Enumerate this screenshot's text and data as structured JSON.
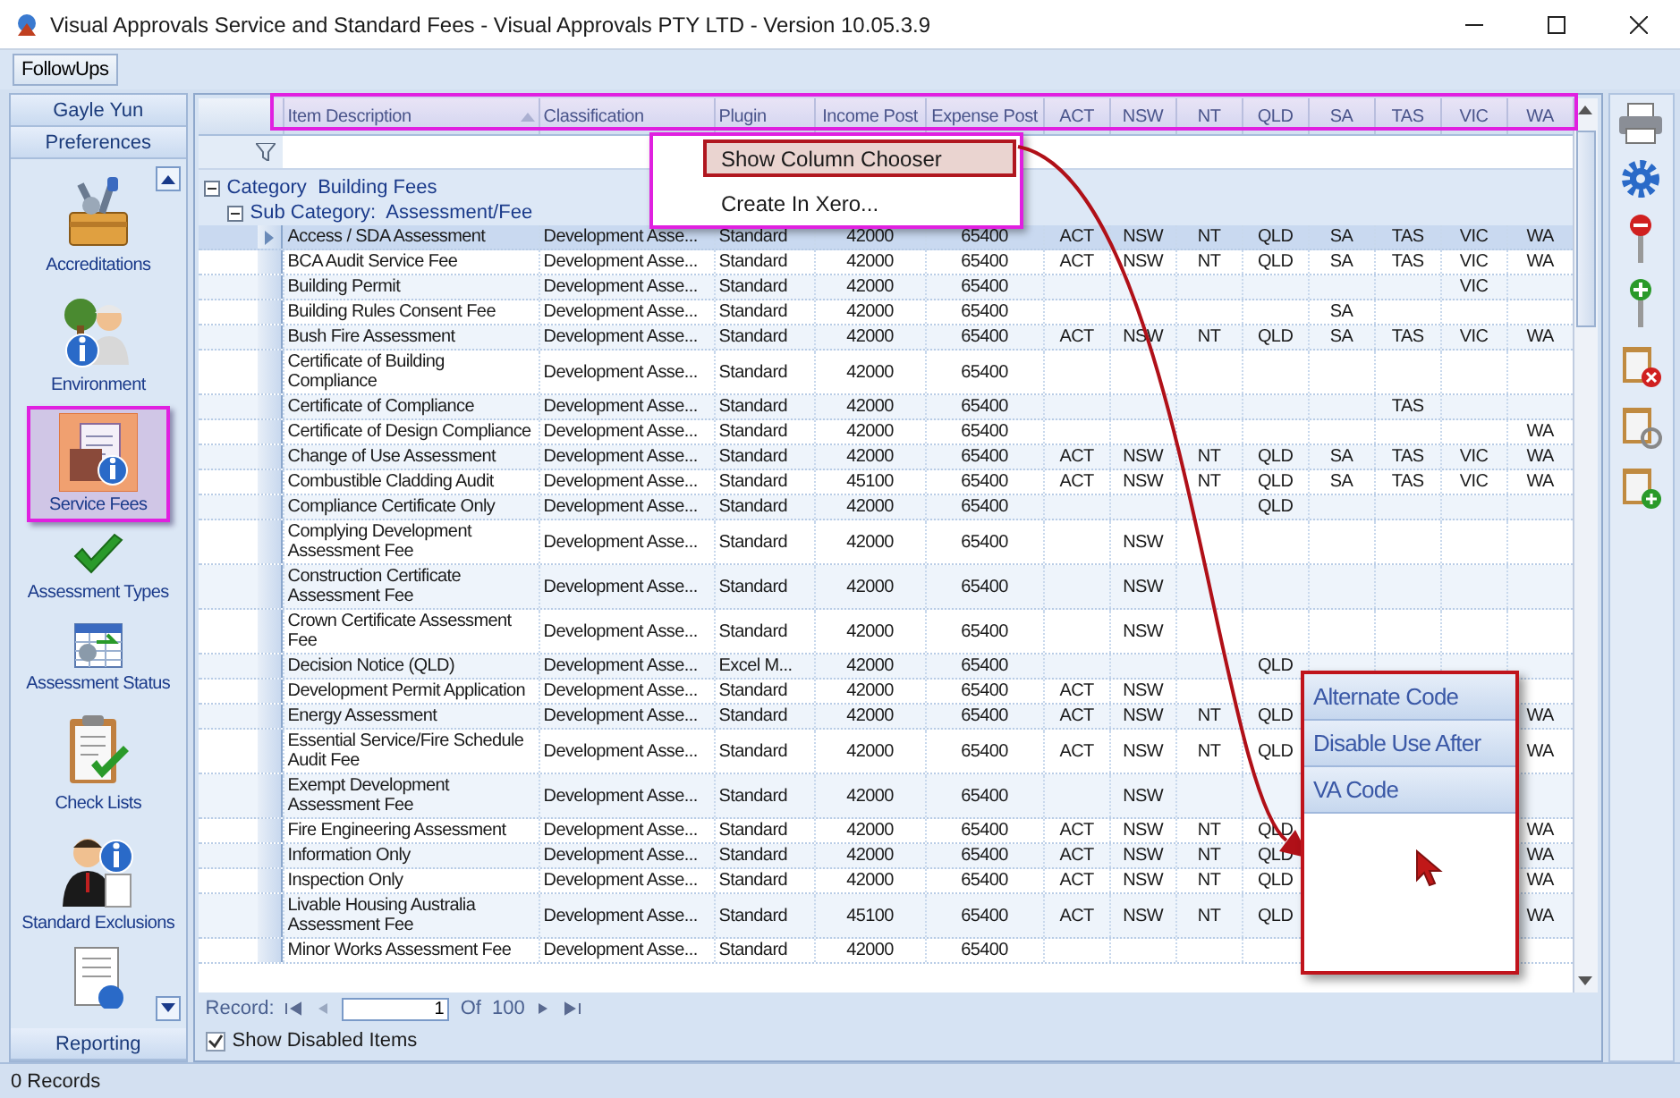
{
  "window": {
    "title": "Visual Approvals Service and Standard Fees - Visual Approvals PTY LTD - Version 10.05.3.9"
  },
  "toolbar": {
    "buttons": [
      "FollowUps"
    ]
  },
  "sidebar": {
    "user": "Gayle Yun",
    "section": "Preferences",
    "items": [
      {
        "label": "Accreditations",
        "selected": false
      },
      {
        "label": "Environment",
        "selected": false
      },
      {
        "label": "Service Fees",
        "selected": true
      },
      {
        "label": "Assessment Types",
        "selected": false
      },
      {
        "label": "Assessment Status",
        "selected": false
      },
      {
        "label": "Check Lists",
        "selected": false
      },
      {
        "label": "Standard Exclusions",
        "selected": false
      }
    ],
    "footer": "Reporting"
  },
  "grid": {
    "columns": [
      {
        "label": "Item Description",
        "sorted": true
      },
      {
        "label": "Classification",
        "sorted": false
      },
      {
        "label": "Plugin",
        "sorted": false
      },
      {
        "label": "Income Post",
        "sorted": false
      },
      {
        "label": "Expense Post",
        "sorted": false
      },
      {
        "label": "ACT",
        "sorted": false
      },
      {
        "label": "NSW",
        "sorted": false
      },
      {
        "label": "NT",
        "sorted": false
      },
      {
        "label": "QLD",
        "sorted": false
      },
      {
        "label": "SA",
        "sorted": false
      },
      {
        "label": "TAS",
        "sorted": false
      },
      {
        "label": "VIC",
        "sorted": false
      },
      {
        "label": "WA",
        "sorted": false
      }
    ],
    "groups": [
      {
        "label": "Category",
        "value": "Building Fees",
        "expanded": true
      },
      {
        "label": "Sub Category:",
        "value": "Assessment/Fee",
        "expanded": true
      }
    ],
    "rows": [
      {
        "selected": true,
        "cells": [
          "Access / SDA Assessment",
          "Development Asse...",
          "Standard",
          "42000",
          "65400",
          "ACT",
          "NSW",
          "NT",
          "QLD",
          "SA",
          "TAS",
          "VIC",
          "WA"
        ]
      },
      {
        "selected": false,
        "cells": [
          "BCA Audit Service Fee",
          "Development Asse...",
          "Standard",
          "42000",
          "65400",
          "ACT",
          "NSW",
          "NT",
          "QLD",
          "SA",
          "TAS",
          "VIC",
          "WA"
        ]
      },
      {
        "selected": false,
        "cells": [
          "Building Permit",
          "Development Asse...",
          "Standard",
          "42000",
          "65400",
          null,
          null,
          null,
          null,
          null,
          null,
          "VIC",
          null
        ]
      },
      {
        "selected": false,
        "cells": [
          "Building Rules Consent Fee",
          "Development Asse...",
          "Standard",
          "42000",
          "65400",
          null,
          null,
          null,
          null,
          "SA",
          null,
          null,
          null
        ]
      },
      {
        "selected": false,
        "cells": [
          "Bush Fire Assessment",
          "Development Asse...",
          "Standard",
          "42000",
          "65400",
          "ACT",
          "NSW",
          "NT",
          "QLD",
          "SA",
          "TAS",
          "VIC",
          "WA"
        ]
      },
      {
        "selected": false,
        "cells": [
          "Certificate of Building Compliance",
          "Development Asse...",
          "Standard",
          "42000",
          "65400",
          null,
          null,
          null,
          null,
          null,
          null,
          null,
          null
        ]
      },
      {
        "selected": false,
        "cells": [
          "Certificate of Compliance",
          "Development Asse...",
          "Standard",
          "42000",
          "65400",
          null,
          null,
          null,
          null,
          null,
          "TAS",
          null,
          null
        ]
      },
      {
        "selected": false,
        "cells": [
          "Certificate of Design Compliance",
          "Development Asse...",
          "Standard",
          "42000",
          "65400",
          null,
          null,
          null,
          null,
          null,
          null,
          null,
          "WA"
        ]
      },
      {
        "selected": false,
        "cells": [
          "Change of Use Assessment",
          "Development Asse...",
          "Standard",
          "42000",
          "65400",
          "ACT",
          "NSW",
          "NT",
          "QLD",
          "SA",
          "TAS",
          "VIC",
          "WA"
        ]
      },
      {
        "selected": false,
        "cells": [
          "Combustible Cladding Audit",
          "Development Asse...",
          "Standard",
          "45100",
          "65400",
          "ACT",
          "NSW",
          "NT",
          "QLD",
          "SA",
          "TAS",
          "VIC",
          "WA"
        ]
      },
      {
        "selected": false,
        "cells": [
          "Compliance Certificate Only",
          "Development Asse...",
          "Standard",
          "42000",
          "65400",
          null,
          null,
          null,
          "QLD",
          null,
          null,
          null,
          null
        ]
      },
      {
        "selected": false,
        "cells": [
          "Complying Development Assessment Fee",
          "Development Asse...",
          "Standard",
          "42000",
          "65400",
          null,
          "NSW",
          null,
          null,
          null,
          null,
          null,
          null
        ]
      },
      {
        "selected": false,
        "cells": [
          "Construction Certificate Assessment Fee",
          "Development Asse...",
          "Standard",
          "42000",
          "65400",
          null,
          "NSW",
          null,
          null,
          null,
          null,
          null,
          null
        ]
      },
      {
        "selected": false,
        "cells": [
          "Crown Certificate Assessment Fee",
          "Development Asse...",
          "Standard",
          "42000",
          "65400",
          null,
          "NSW",
          null,
          null,
          null,
          null,
          null,
          null
        ]
      },
      {
        "selected": false,
        "cells": [
          "Decision Notice (QLD)",
          "Development Asse...",
          "Excel M...",
          "42000",
          "65400",
          null,
          null,
          null,
          "QLD",
          null,
          null,
          null,
          null
        ]
      },
      {
        "selected": false,
        "cells": [
          "Development Permit Application",
          "Development Asse...",
          "Standard",
          "42000",
          "65400",
          "ACT",
          "NSW",
          null,
          null,
          null,
          null,
          null,
          null
        ]
      },
      {
        "selected": false,
        "cells": [
          "Energy Assessment",
          "Development Asse...",
          "Standard",
          "42000",
          "65400",
          "ACT",
          "NSW",
          "NT",
          "QLD",
          null,
          null,
          null,
          "WA"
        ]
      },
      {
        "selected": false,
        "cells": [
          "Essential Service/Fire Schedule Audit Fee",
          "Development Asse...",
          "Standard",
          "42000",
          "65400",
          "ACT",
          "NSW",
          "NT",
          "QLD",
          null,
          null,
          null,
          "WA"
        ]
      },
      {
        "selected": false,
        "cells": [
          "Exempt Development Assessment Fee",
          "Development Asse...",
          "Standard",
          "42000",
          "65400",
          null,
          "NSW",
          null,
          null,
          null,
          null,
          null,
          null
        ]
      },
      {
        "selected": false,
        "cells": [
          "Fire Engineering Assessment",
          "Development Asse...",
          "Standard",
          "42000",
          "65400",
          "ACT",
          "NSW",
          "NT",
          "QLD",
          null,
          null,
          null,
          "WA"
        ]
      },
      {
        "selected": false,
        "cells": [
          "Information Only",
          "Development Asse...",
          "Standard",
          "42000",
          "65400",
          "ACT",
          "NSW",
          "NT",
          "QLD",
          null,
          null,
          null,
          "WA"
        ]
      },
      {
        "selected": false,
        "cells": [
          "Inspection Only",
          "Development Asse...",
          "Standard",
          "42000",
          "65400",
          "ACT",
          "NSW",
          "NT",
          "QLD",
          null,
          null,
          null,
          "WA"
        ]
      },
      {
        "selected": false,
        "cells": [
          "Livable Housing Australia Assessment Fee",
          "Development Asse...",
          "Standard",
          "45100",
          "65400",
          "ACT",
          "NSW",
          "NT",
          "QLD",
          null,
          null,
          null,
          "WA"
        ]
      },
      {
        "selected": false,
        "cells": [
          "Minor Works Assessment Fee",
          "Development Asse...",
          "Standard",
          "42000",
          "65400",
          null,
          null,
          null,
          null,
          null,
          null,
          null,
          null
        ]
      }
    ],
    "navigator": {
      "label": "Record:",
      "page": "1",
      "of": "Of",
      "total": "100"
    },
    "show_disabled": {
      "label": "Show Disabled Items",
      "checked": true
    }
  },
  "context_menu": {
    "items": [
      {
        "label": "Show Column Chooser",
        "selected": true
      },
      {
        "label": "Create In Xero...",
        "selected": false
      }
    ]
  },
  "column_chooser": {
    "items": [
      "Alternate Code",
      "Disable Use After",
      "VA Code"
    ]
  },
  "status_bar": "0 Records"
}
